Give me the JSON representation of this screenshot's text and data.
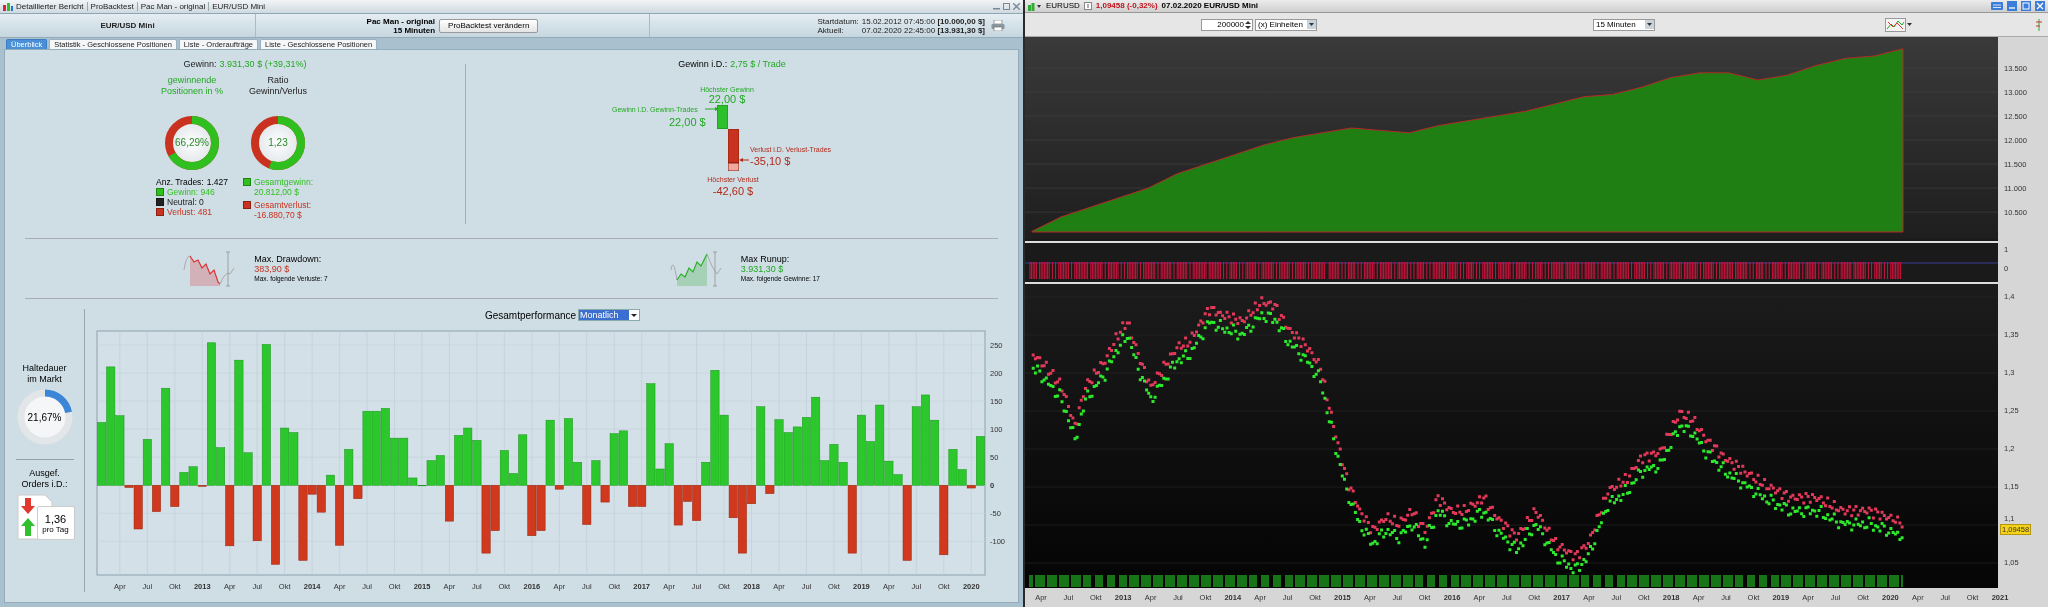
{
  "report": {
    "title_parts": [
      "Detaillierter Bericht",
      "ProBacktest",
      "Pac Man - original",
      "EUR/USD Mini"
    ],
    "instrument": "EUR/USD Mini",
    "strategy": {
      "name": "Pac Man - original",
      "timeframe": "15 Minuten",
      "button": "ProBacktest verändern"
    },
    "dates": [
      {
        "label": "Startdatum:",
        "value": "15.02.2012 07:45:00 **[10.000,00 $]**"
      },
      {
        "label": "Aktuell:",
        "value": "07.02.2020 22:45:00 **[13.931,30 $]**"
      }
    ],
    "tabs": [
      {
        "label": "Überblick",
        "selected": true
      },
      {
        "label": "Statistik - Geschlossene Positionen",
        "selected": false
      },
      {
        "label": "Liste - Orderaufträge",
        "selected": false
      },
      {
        "label": "Liste - Geschlossene Positionen",
        "selected": false
      }
    ],
    "gain": {
      "label": "Gewinn:",
      "value": "3.931,30 $ (+39,31%)"
    },
    "donuts": [
      {
        "title": "gewinnende Positionen in %",
        "value": "66,29%",
        "level": 0.6629
      },
      {
        "title": "Ratio Gewinn/Verlus",
        "value": "1,23",
        "level": 0.552
      }
    ],
    "trades": {
      "label": "Anz. Trades:",
      "value": "1.427"
    },
    "legend": [
      {
        "text": "Gewinn: 946",
        "color": "#2fbf1f"
      },
      {
        "text": "Neutral: 0",
        "color": "#222222"
      },
      {
        "text": "Verlust: 481",
        "color": "#c8321e"
      }
    ],
    "totals": [
      {
        "label": "Gesamtgewinn:",
        "value": "20.812,00 $",
        "color": "#2fbf1f"
      },
      {
        "label": "Gesamtverlust:",
        "value": "-16.880,70 $",
        "color": "#c8321e"
      }
    ],
    "per_trade": {
      "label": "Gewinn i.D.:",
      "value": "2,75 $ / Trade",
      "best": {
        "caption": "Höchster Gewinn",
        "value": "22,00 $"
      },
      "avg_win": {
        "caption": "Gewinn i.D. Gewinn-Trades",
        "value": "22,00 $"
      },
      "avg_loss": {
        "caption": "Verlust i.D. Verlust-Trades",
        "value": "-35,10 $"
      },
      "worst": {
        "caption": "Höchster Verlust",
        "value": "-42,60 $"
      }
    },
    "drawdown": {
      "title": "Max. Drawdown:",
      "value": "383,90 $",
      "note": "Max. folgende Verluste: 7"
    },
    "runup": {
      "title": "Max Runup:",
      "value": "3.931,30 $",
      "note": "Max. folgende Gewinne: 17"
    },
    "holding": {
      "title": "Haltedauer im Markt",
      "value": "21,67%",
      "level": 0.2167
    },
    "orders": {
      "title": "Ausgef. Orders i.D.:",
      "value": "1,36",
      "unit": "pro Tag"
    },
    "performance": {
      "label": "Gesamtperformance",
      "period": "Monatlich",
      "chart_data": {
        "type": "bar",
        "ylim": [
          -160,
          275
        ],
        "grid": true,
        "categories": [
          null,
          null,
          "Apr",
          null,
          null,
          "Jul",
          null,
          null,
          "Okt",
          null,
          null,
          "2013",
          null,
          null,
          "Apr",
          null,
          null,
          "Jul",
          null,
          null,
          "Okt",
          null,
          null,
          "2014",
          null,
          null,
          "Apr",
          null,
          null,
          "Jul",
          null,
          null,
          "Okt",
          null,
          null,
          "2015",
          null,
          null,
          "Apr",
          null,
          null,
          "Jul",
          null,
          null,
          "Okt",
          null,
          null,
          "2016",
          null,
          null,
          "Apr",
          null,
          null,
          "Jul",
          null,
          null,
          "Okt",
          null,
          null,
          "2017",
          null,
          null,
          "Apr",
          null,
          null,
          "Jul",
          null,
          null,
          "Okt",
          null,
          null,
          "2018",
          null,
          null,
          "Apr",
          null,
          null,
          "Jul",
          null,
          null,
          "Okt",
          null,
          null,
          "2019",
          null,
          null,
          "Apr",
          null,
          null,
          "Jul",
          null,
          null,
          "Okt",
          null,
          null,
          "2020",
          null
        ],
        "values": [
          112,
          211,
          124,
          -4,
          -78,
          82,
          -47,
          173,
          -38,
          23,
          33,
          -2,
          254,
          67,
          -108,
          223,
          58,
          -99,
          251,
          -141,
          102,
          94,
          -134,
          -16,
          -48,
          18,
          -107,
          64,
          -24,
          132,
          132,
          137,
          84,
          84,
          13,
          0,
          44,
          53,
          -64,
          89,
          102,
          80,
          -121,
          -81,
          62,
          21,
          90,
          -90,
          -81,
          116,
          -7,
          119,
          41,
          -70,
          44,
          -30,
          92,
          97,
          -38,
          -38,
          181,
          29,
          74,
          -71,
          -29,
          -63,
          41,
          205,
          125,
          -58,
          -121,
          -33,
          140,
          -15,
          117,
          94,
          104,
          121,
          157,
          44,
          73,
          41,
          -121,
          125,
          78,
          143,
          43,
          19,
          -134,
          140,
          161,
          116,
          -124,
          64,
          28,
          -5,
          87
        ],
        "yticks": [
          -100,
          -50,
          0,
          50,
          100,
          150,
          200,
          250
        ]
      }
    }
  },
  "chart_window": {
    "symbol": "EURUSD",
    "quote": "1,09458 (-0,32%)",
    "date_instrument": "07.02.2020 EUR/USD Mini",
    "quantity": "200000",
    "unit": "(x) Einheiten",
    "timeframe": "15 Minuten",
    "equity": {
      "chart_data": {
        "type": "area",
        "ylim": [
          9940,
          14145
        ],
        "grid": true,
        "yticks": [
          {
            "value": 13500,
            "label": "13.500"
          },
          {
            "value": 13000,
            "label": "13.000"
          },
          {
            "value": 12500,
            "label": "12.500"
          },
          {
            "value": 12000,
            "label": "12.000"
          },
          {
            "value": 11500,
            "label": "11.500"
          },
          {
            "value": 11000,
            "label": "11.000"
          },
          {
            "value": 10500,
            "label": "10.500"
          }
        ],
        "values": [
          10100,
          10400,
          10600,
          10800,
          11000,
          11300,
          11500,
          11700,
          11900,
          12050,
          12150,
          12250,
          12200,
          12150,
          12300,
          12400,
          12500,
          12600,
          12750,
          12900,
          12950,
          13100,
          13300,
          13400,
          13400,
          13250,
          13350,
          13550,
          13700,
          13750,
          13900
        ]
      }
    },
    "indicator_axis": [
      "1",
      "0"
    ],
    "price_axis": [
      "1,4",
      "1,35",
      "1,3",
      "1,25",
      "1,2",
      "1,15",
      "1,1",
      "1,05"
    ],
    "last_price": "1,09458",
    "time_axis": [
      "Apr",
      "Jul",
      "Okt",
      "2013",
      "Apr",
      "Jul",
      "Okt",
      "2014",
      "Apr",
      "Jul",
      "Okt",
      "2015",
      "Apr",
      "Jul",
      "Okt",
      "2016",
      "Apr",
      "Jul",
      "Okt",
      "2017",
      "Apr",
      "Jul",
      "Okt",
      "2018",
      "Apr",
      "Jul",
      "Okt",
      "2019",
      "Apr",
      "Jul",
      "Okt",
      "2020",
      "Apr",
      "Jul",
      "Okt",
      "2021"
    ]
  }
}
